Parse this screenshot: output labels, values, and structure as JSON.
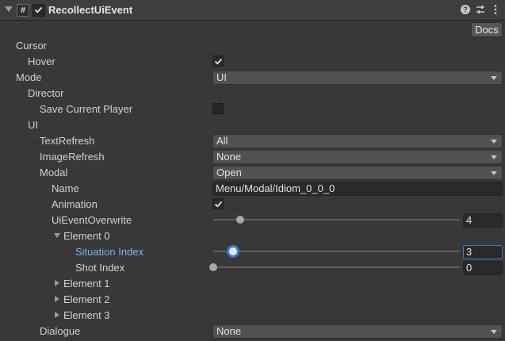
{
  "component": {
    "title": "RecollectUiEvent",
    "script_icon_glyph": "#",
    "enabled": true,
    "icons": [
      "help-icon",
      "presets-icon",
      "more-icon"
    ]
  },
  "docs_label": "Docs",
  "fields": {
    "cursor": "Cursor",
    "hover": {
      "label": "Hover",
      "checked": true
    },
    "mode": {
      "label": "Mode",
      "value": "UI"
    },
    "director": "Director",
    "save_current_player": {
      "label": "Save Current Player",
      "checked": false
    },
    "ui": "UI",
    "text_refresh": {
      "label": "TextRefresh",
      "value": "All"
    },
    "image_refresh": {
      "label": "ImageRefresh",
      "value": "None"
    },
    "modal": {
      "label": "Modal",
      "value": "Open"
    },
    "name": {
      "label": "Name",
      "value": "Menu/Modal/Idiom_0_0_0"
    },
    "animation": {
      "label": "Animation",
      "checked": true
    },
    "ui_event_overwrite": {
      "label": "UiEventOverwrite",
      "value": "4",
      "fraction": 0.11
    },
    "element0": "Element 0",
    "situation_index": {
      "label": "Situation Index",
      "value": "3",
      "fraction": 0.08
    },
    "shot_index": {
      "label": "Shot Index",
      "value": "0",
      "fraction": 0.0
    },
    "element1": "Element 1",
    "element2": "Element 2",
    "element3": "Element 3",
    "dialogue": {
      "label": "Dialogue",
      "value": "None"
    }
  },
  "colors": {
    "selected_label": "#7fb2f0",
    "focus_outline": "#3d79c9"
  }
}
